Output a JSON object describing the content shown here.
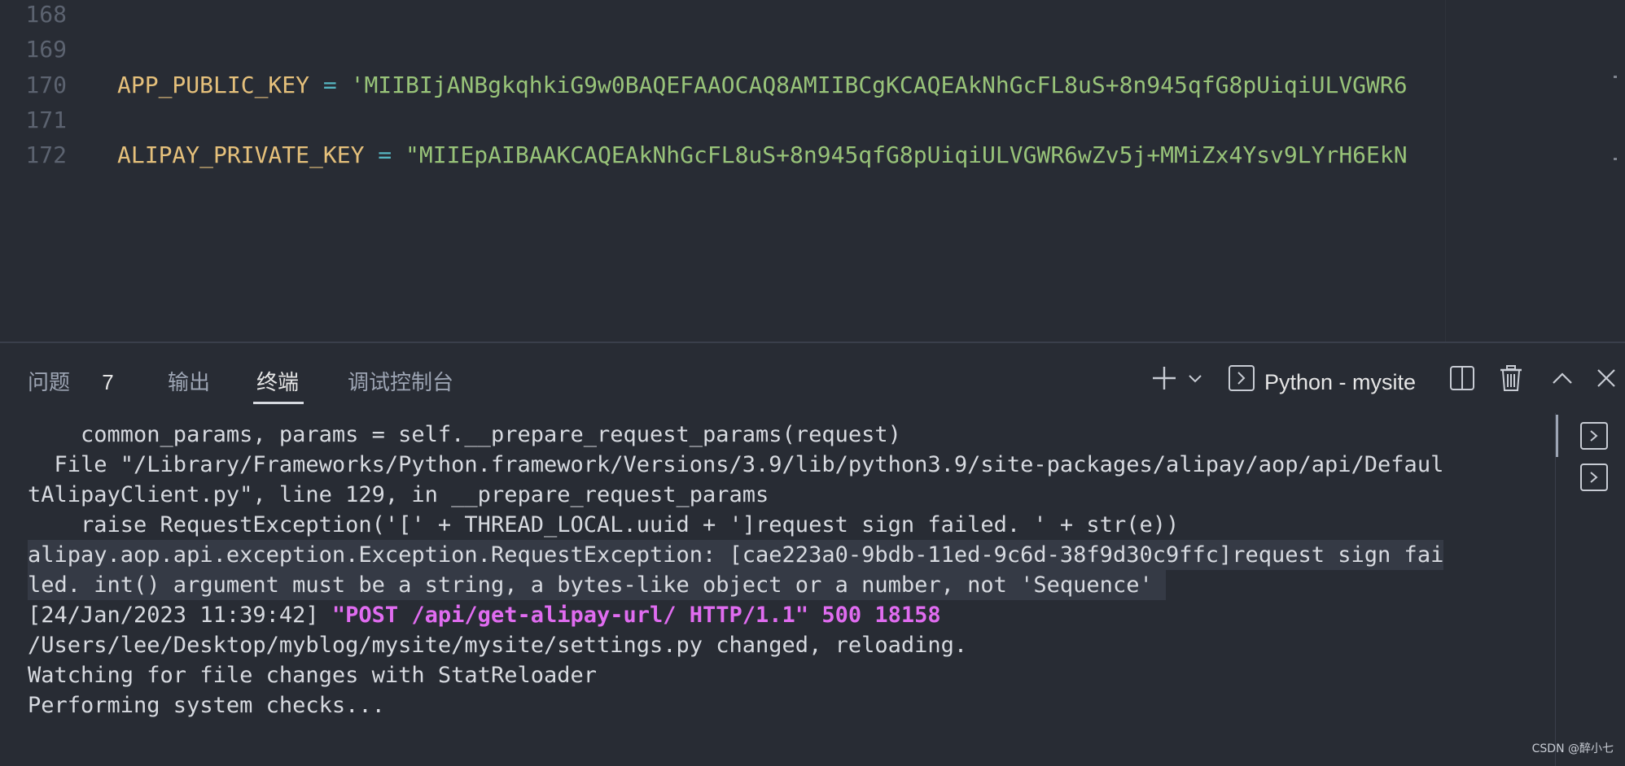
{
  "editor": {
    "lines": [
      {
        "number": "168",
        "var": "",
        "op": "",
        "value": ""
      },
      {
        "number": "169",
        "var": "",
        "op": "",
        "value": ""
      },
      {
        "number": "170",
        "var": "APP_PUBLIC_KEY",
        "op": "=",
        "value": "'MIIBIjANBgkqhkiG9w0BAQEFAAOCAQ8AMIIBCgKCAQEAkNhGcFL8uS+8n945qfG8pUiqiULVGWR6"
      },
      {
        "number": "171",
        "var": "",
        "op": "",
        "value": ""
      },
      {
        "number": "172",
        "var": "ALIPAY_PRIVATE_KEY",
        "op": "=",
        "value": "\"MIIEpAIBAAKCAQEAkNhGcFL8uS+8n945qfG8pUiqiULVGWR6wZv5j+MMiZx4Ysv9LYrH6EkN"
      }
    ]
  },
  "panel": {
    "tabs": [
      {
        "label": "问题",
        "badge": "7"
      },
      {
        "label": "输出",
        "badge": ""
      },
      {
        "label": "终端",
        "badge": ""
      },
      {
        "label": "调试控制台",
        "badge": ""
      }
    ],
    "active_tab": "终端",
    "terminal_name": "Python - mysite",
    "icons": {
      "add": "plus-icon",
      "dropdown": "chevron-down-icon",
      "terminal": "terminal-icon",
      "split": "split-icon",
      "trash": "trash-icon",
      "maximize": "chevron-up-icon",
      "close": "close-icon"
    }
  },
  "terminal": {
    "lines": [
      "    common_params, params = self.__prepare_request_params(request)",
      "  File \"/Library/Frameworks/Python.framework/Versions/3.9/lib/python3.9/site-packages/alipay/aop/api/Defaul",
      "tAlipayClient.py\", line 129, in __prepare_request_params",
      "    raise RequestException('[' + THREAD_LOCAL.uuid + ']request sign failed. ' + str(e))",
      "alipay.aop.api.exception.Exception.RequestException: [cae223a0-9bdb-11ed-9c6d-38f9d30c9ffc]request sign fai",
      "led. int() argument must be a string, a bytes-like object or a number, not 'Sequence' ",
      "/Users/lee/Desktop/myblog/mysite/mysite/settings.py changed, reloading.",
      "Watching for file changes with StatReloader",
      "Performing system checks..."
    ],
    "log_prefix": "[24/Jan/2023 11:39:42] ",
    "log_request": "\"POST /api/get-alipay-url/ HTTP/1.1\" 500 18158"
  },
  "watermark": "CSDN @醉小七",
  "colors": {
    "background": "#282c34",
    "variable": "#e5c07b",
    "operator": "#56b6c2",
    "string": "#98c379",
    "line_number": "#5c6370",
    "http_request": "#e06cf0"
  }
}
